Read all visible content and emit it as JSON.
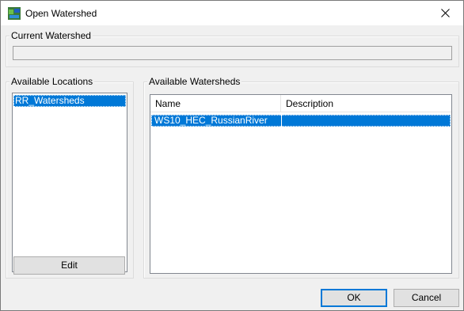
{
  "window": {
    "title": "Open Watershed",
    "close_glyph": "✕"
  },
  "current_watershed": {
    "label": "Current Watershed",
    "value": ""
  },
  "locations": {
    "label": "Available Locations",
    "items": [
      {
        "label": "RR_Watersheds",
        "selected": true
      }
    ],
    "edit_label": "Edit"
  },
  "watersheds": {
    "label": "Available Watersheds",
    "columns": [
      "Name",
      "Description"
    ],
    "rows": [
      {
        "name": "WS10_HEC_RussianRiver",
        "description": "",
        "selected": true
      }
    ]
  },
  "buttons": {
    "ok": "OK",
    "cancel": "Cancel"
  },
  "colors": {
    "selection": "#0078d7",
    "default_button_border": "#0078d7"
  }
}
